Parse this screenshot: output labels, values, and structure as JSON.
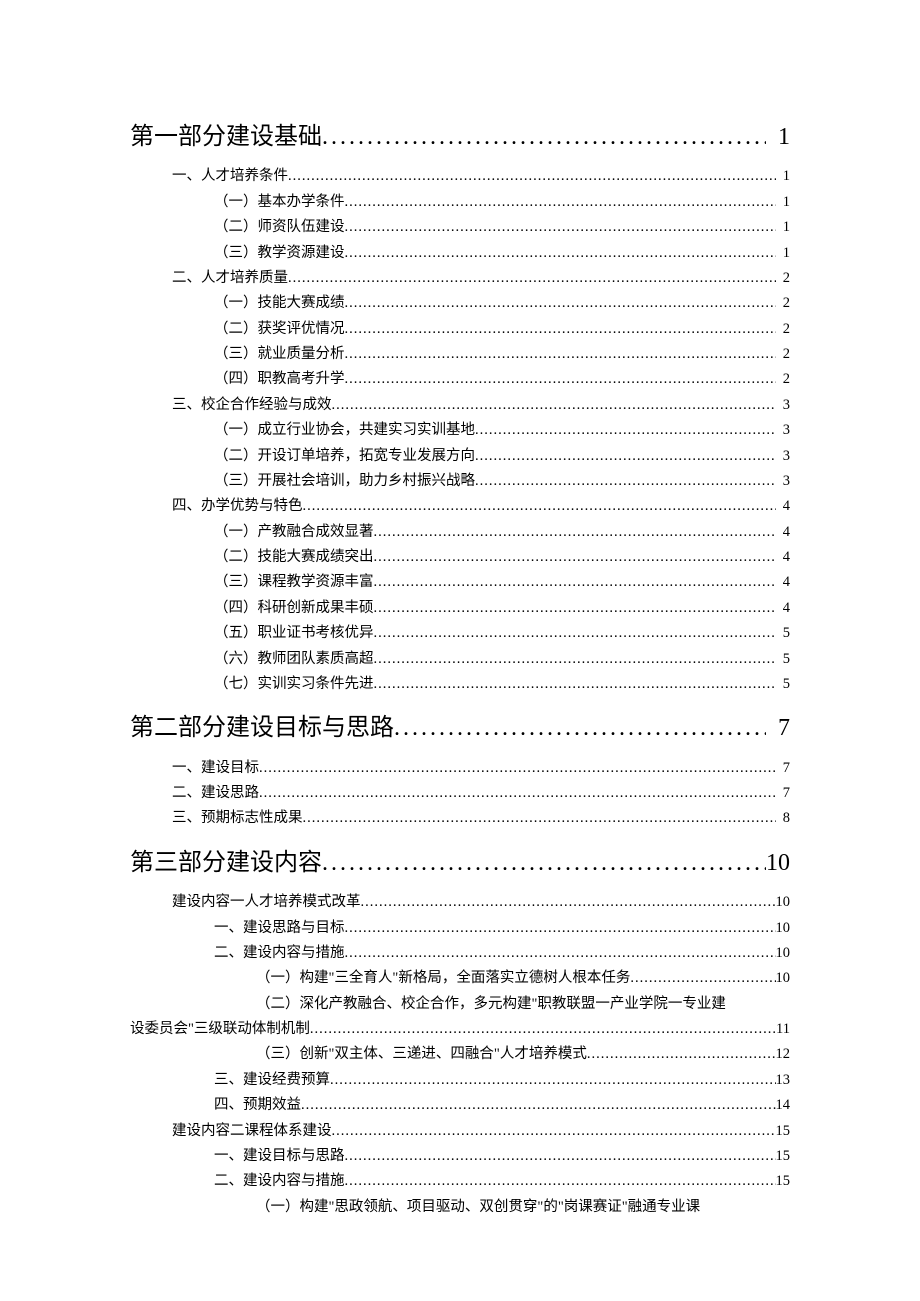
{
  "toc": [
    {
      "level": "h1",
      "label": "第一部分建设基础",
      "page": "1"
    },
    {
      "level": "l1",
      "label": "一、人才培养条件",
      "page": "1"
    },
    {
      "level": "l2",
      "label": "（一）基本办学条件",
      "page": "1"
    },
    {
      "level": "l2",
      "label": "（二）师资队伍建设",
      "page": "1"
    },
    {
      "level": "l2",
      "label": "（三）教学资源建设",
      "page": "1"
    },
    {
      "level": "l1",
      "label": "二、人才培养质量",
      "page": "2"
    },
    {
      "level": "l2",
      "label": "（一）技能大赛成绩",
      "page": "2"
    },
    {
      "level": "l2",
      "label": "（二）获奖评优情况",
      "page": "2"
    },
    {
      "level": "l2",
      "label": "（三）就业质量分析",
      "page": "2"
    },
    {
      "level": "l2",
      "label": "（四）职教高考升学",
      "page": "2"
    },
    {
      "level": "l1",
      "label": "三、校企合作经验与成效",
      "page": "3"
    },
    {
      "level": "l2",
      "label": "（一）成立行业协会，共建实习实训基地",
      "page": "3"
    },
    {
      "level": "l2",
      "label": "（二）开设订单培养，拓宽专业发展方向",
      "page": "3"
    },
    {
      "level": "l2",
      "label": "（三）开展社会培训，助力乡村振兴战略",
      "page": "3"
    },
    {
      "level": "l1",
      "label": "四、办学优势与特色",
      "page": "4"
    },
    {
      "level": "l2",
      "label": "（一）产教融合成效显著",
      "page": "4"
    },
    {
      "level": "l2",
      "label": "（二）技能大赛成绩突出",
      "page": "4"
    },
    {
      "level": "l2",
      "label": "（三）课程教学资源丰富",
      "page": "4"
    },
    {
      "level": "l2",
      "label": "（四）科研创新成果丰硕",
      "page": "4"
    },
    {
      "level": "l2",
      "label": "（五）职业证书考核优异",
      "page": "5"
    },
    {
      "level": "l2",
      "label": "（六）教师团队素质高超",
      "page": "5"
    },
    {
      "level": "l2",
      "label": "（七）实训实习条件先进",
      "page": "5"
    },
    {
      "level": "h1",
      "label": "第二部分建设目标与思路",
      "page": "7"
    },
    {
      "level": "l1",
      "label": "一、建设目标",
      "page": "7"
    },
    {
      "level": "l1",
      "label": "二、建设思路",
      "page": "7"
    },
    {
      "level": "l1",
      "label": "三、预期标志性成果",
      "page": "8"
    },
    {
      "level": "h1",
      "label": "第三部分建设内容",
      "page": "10"
    },
    {
      "level": "l1",
      "label": "建设内容一人才培养模式改革",
      "page": "10"
    },
    {
      "level": "l2",
      "label": "一、建设思路与目标",
      "page": "10"
    },
    {
      "level": "l2",
      "label": "二、建设内容与措施",
      "page": "10"
    },
    {
      "level": "l3",
      "label": "（一）构建\"三全育人\"新格局，全面落实立德树人根本任务",
      "page": "10"
    },
    {
      "level": "l3wrap",
      "label_a": "（二）深化产教融合、校企合作，多元构建\"职教联盟一产业学院一专业建",
      "label_b": "设委员会\"三级联动体制机制",
      "page": "11"
    },
    {
      "level": "l3",
      "label": "（三）创新\"双主体、三递进、四融合\"人才培养模式",
      "page": "12"
    },
    {
      "level": "l2",
      "label": "三、建设经费预算",
      "page": "13"
    },
    {
      "level": "l2",
      "label": "四、预期效益",
      "page": "14"
    },
    {
      "level": "l1",
      "label": "建设内容二课程体系建设",
      "page": "15"
    },
    {
      "level": "l2",
      "label": "一、建设目标与思路",
      "page": "15"
    },
    {
      "level": "l2",
      "label": "二、建设内容与措施",
      "page": "15"
    },
    {
      "level": "l3tail",
      "label": "（一）构建\"思政领航、项目驱动、双创贯穿\"的\"岗课赛证\"融通专业课"
    }
  ]
}
